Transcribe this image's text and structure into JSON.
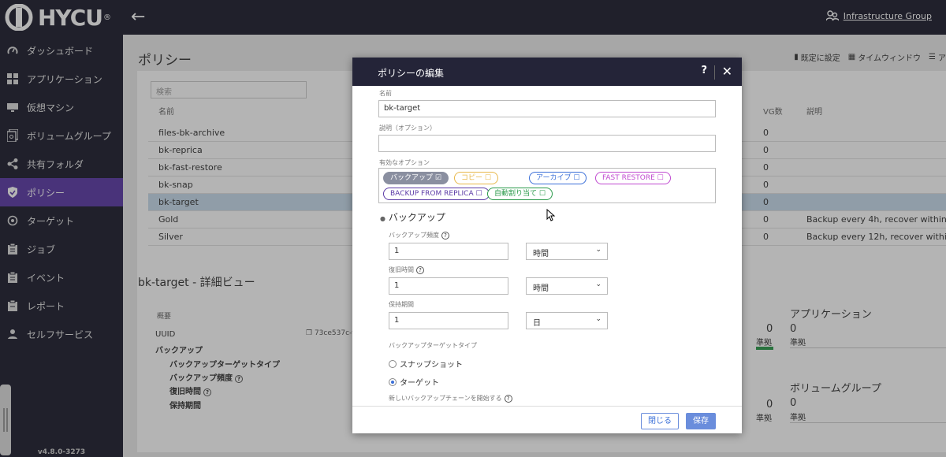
{
  "app": {
    "brand": "HYCU",
    "tenant": "Infrastructure Group",
    "version": "v4.8.0-3273"
  },
  "sidebar": {
    "items": [
      {
        "label": "ダッシュボード",
        "icon": "dashboard-gauge-icon"
      },
      {
        "label": "アプリケーション",
        "icon": "applications-grid-icon"
      },
      {
        "label": "仮想マシン",
        "icon": "monitor-icon"
      },
      {
        "label": "ボリュームグループ",
        "icon": "volume-group-icon"
      },
      {
        "label": "共有フォルダ",
        "icon": "share-icon"
      },
      {
        "label": "ポリシー",
        "icon": "shield-icon",
        "active": true
      },
      {
        "label": "ターゲット",
        "icon": "target-icon"
      },
      {
        "label": "ジョブ",
        "icon": "clipboard-icon"
      },
      {
        "label": "イベント",
        "icon": "clipboard-icon"
      },
      {
        "label": "レポート",
        "icon": "report-icon"
      },
      {
        "label": "セルフサービス",
        "icon": "self-service-icon"
      }
    ]
  },
  "page": {
    "title": "ポリシー",
    "actions": [
      "既定に設定",
      "タイムウィンドウ",
      "ア"
    ],
    "search_placeholder": "検索",
    "columns": {
      "name": "名前",
      "vg_count": "VG数",
      "description": "説明"
    },
    "rows": [
      {
        "name": "files-bk-archive",
        "vg": "0",
        "desc": ""
      },
      {
        "name": "bk-reprica",
        "vg": "0",
        "desc": ""
      },
      {
        "name": "bk-fast-restore",
        "vg": "0",
        "desc": ""
      },
      {
        "name": "bk-snap",
        "vg": "0",
        "desc": ""
      },
      {
        "name": "bk-target",
        "vg": "0",
        "desc": "",
        "selected": true
      },
      {
        "name": "Gold",
        "vg": "0",
        "desc": "Backup every 4h, recover within 4h"
      },
      {
        "name": "Silver",
        "vg": "0",
        "desc": "Backup every 12h, recover within 12h"
      }
    ],
    "detail_title": "bk-target - 詳細ビュー",
    "detail": {
      "overview": "概要",
      "uuid_label": "UUID",
      "uuid_value": "73ce537c-f",
      "backup_label": "バックアップ",
      "fields": [
        "バックアップターゲットタイプ",
        "バックアップ頻度",
        "復旧時間",
        "保持期間"
      ],
      "apps_title": "アプリケーション",
      "apps_count": "0",
      "apps_status": "準拠",
      "vg_title": "ボリュームグループ",
      "vg_count": "0",
      "vg_status": "準拠",
      "left_count_1": "0",
      "left_status_1": "準拠",
      "left_count_2": "0",
      "left_status_2": "準拠"
    }
  },
  "modal": {
    "title": "ポリシーの編集",
    "help": "?",
    "name_label": "名前",
    "name_value": "bk-target",
    "desc_label": "説明（オプション）",
    "desc_value": "",
    "options_label": "有効なオプション",
    "chips": [
      {
        "label": "バックアップ",
        "on": true,
        "color": "#8a8fa0"
      },
      {
        "label": "コピー",
        "on": false,
        "color": "#e8b84a"
      },
      {
        "label": "アーカイブ",
        "on": false,
        "color": "#3a6fd8"
      },
      {
        "label": "FAST RESTORE",
        "on": false,
        "color": "#c04ad0"
      },
      {
        "label": "BACKUP FROM REPLICA",
        "on": false,
        "color": "#5b3aa6"
      },
      {
        "label": "自動割り当て",
        "on": false,
        "color": "#2a9a4a"
      }
    ],
    "section": "バックアップ",
    "freq_label": "バックアップ頻度",
    "freq_value": "1",
    "freq_unit": "時間",
    "rto_label": "復旧時間",
    "rto_value": "1",
    "rto_unit": "時間",
    "ret_label": "保持期間",
    "ret_value": "1",
    "ret_unit": "日",
    "target_type_label": "バックアップターゲットタイプ",
    "radio_snapshot": "スナップショット",
    "radio_target": "ターゲット",
    "new_chain_label": "新しいバックアップチェーンを開始する",
    "close_btn": "閉じる",
    "save_btn": "保存"
  }
}
